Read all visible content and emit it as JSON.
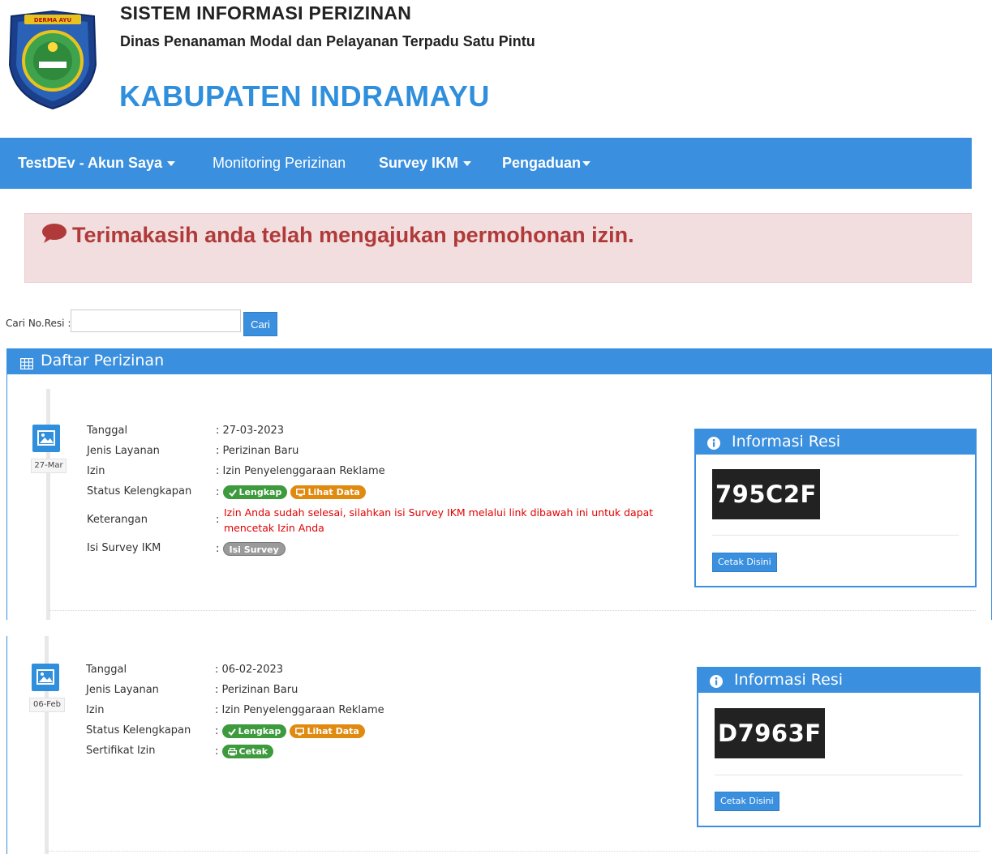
{
  "header": {
    "title": "SISTEM INFORMASI PERIZINAN",
    "subtitle": "Dinas Penanaman Modal dan Pelayanan Terpadu Satu Pintu",
    "kabupaten": "KABUPATEN INDRAMAYU",
    "logo_text": "DERMA AYU"
  },
  "nav": {
    "account": "TestDEv - Akun Saya",
    "monitoring": "Monitoring Perizinan",
    "survey": "Survey IKM",
    "pengaduan": "Pengaduan"
  },
  "alert": {
    "message": "Terimakasih anda telah mengajukan permohonan izin."
  },
  "search": {
    "label": "Cari No.Resi :",
    "value": "",
    "button": "Cari"
  },
  "panel": {
    "title": "Daftar Perizinan"
  },
  "records": [
    {
      "date_badge": "27-Mar",
      "labels": {
        "tanggal": "Tanggal",
        "jenis": "Jenis Layanan",
        "izin": "Izin",
        "status": "Status Kelengkapan",
        "keterangan": "Keterangan",
        "survey": "Isi Survey IKM"
      },
      "tanggal": ": 27-03-2023",
      "jenis": ": Perizinan Baru",
      "izin": ": Izin Penyelenggaraan Reklame",
      "colon": ":",
      "lengkap": "Lengkap",
      "lihat_data": "Lihat Data",
      "keterangan": "Izin Anda sudah selesai, silahkan isi Survey IKM melalui link dibawah ini untuk dapat mencetak Izin Anda",
      "survey_btn": "Isi Survey",
      "info_title": "Informasi Resi",
      "resi": "795C2F",
      "cetak_btn": "Cetak Disini"
    },
    {
      "date_badge": "06-Feb",
      "labels": {
        "tanggal": "Tanggal",
        "jenis": "Jenis Layanan",
        "izin": "Izin",
        "status": "Status Kelengkapan",
        "sertifikat": "Sertifikat Izin"
      },
      "tanggal": ": 06-02-2023",
      "jenis": ": Perizinan Baru",
      "izin": ": Izin Penyelenggaraan Reklame",
      "colon": ":",
      "lengkap": "Lengkap",
      "lihat_data": "Lihat Data",
      "cetak_pill": "Cetak",
      "info_title": "Informasi Resi",
      "resi": "D7963F",
      "cetak_btn": "Cetak Disini"
    }
  ],
  "colors": {
    "primary": "#3a8fde",
    "alert_bg": "#f2dede",
    "alert_text": "#b03a3a",
    "success": "#3d9a3d",
    "warning": "#e08a10",
    "danger_text": "#e00000"
  }
}
